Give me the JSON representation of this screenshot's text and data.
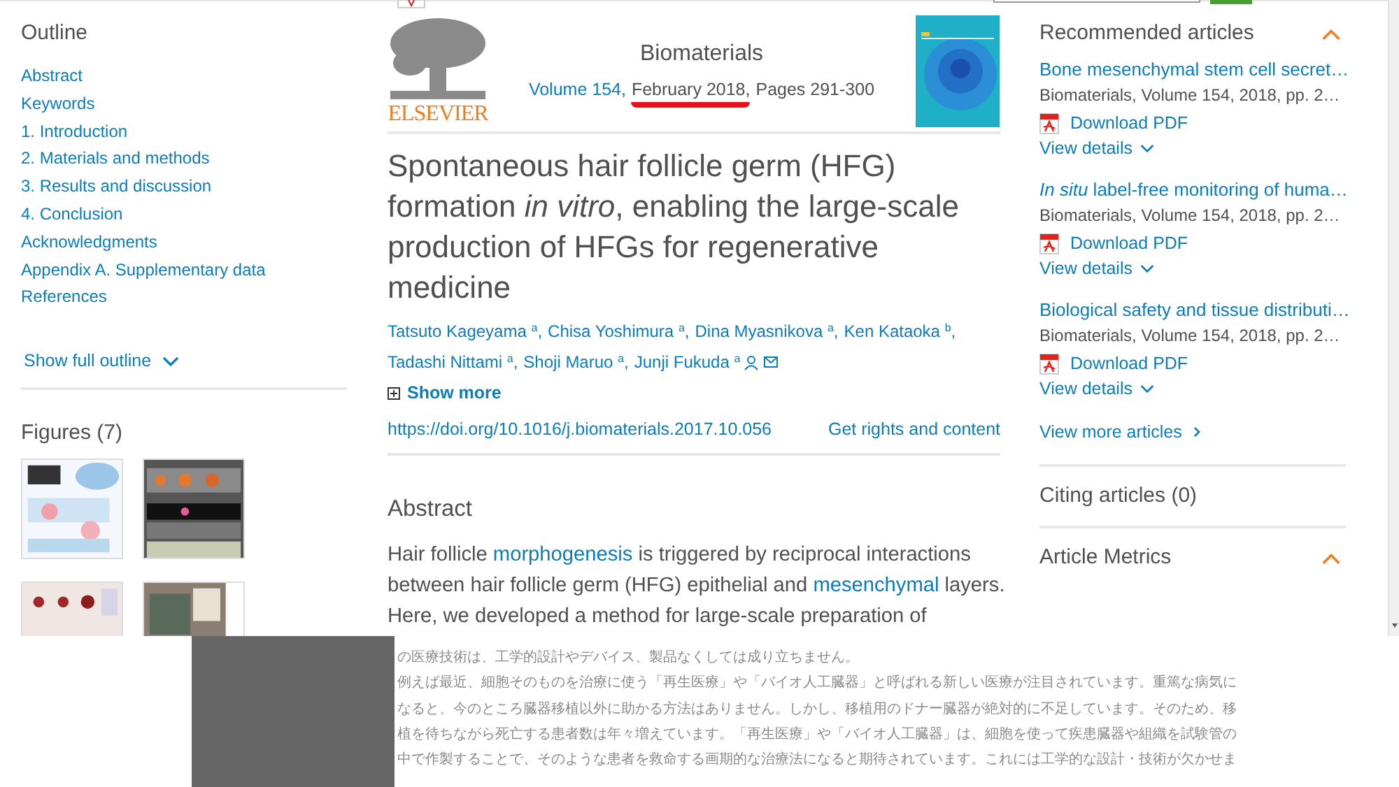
{
  "outline": {
    "title": "Outline",
    "items": [
      "Abstract",
      "Keywords",
      "1. Introduction",
      "2. Materials and methods",
      "3. Results and discussion",
      "4. Conclusion",
      "Acknowledgments",
      "Appendix A. Supplementary data",
      "References"
    ],
    "show_full": "Show full outline"
  },
  "figures": {
    "title": "Figures (7)"
  },
  "journal": {
    "publisher": "ELSEVIER",
    "name": "Biomaterials",
    "volume": "Volume 154,",
    "date": "February 2018,",
    "date_highlighted": true,
    "pages": "Pages 291-300"
  },
  "article": {
    "title": "Spontaneous hair follicle germ (HFG) formation *in vitro*, enabling the large-scale production of HFGs for regenerative medicine",
    "authors": [
      {
        "name": "Tatsuto Kageyama",
        "affiliation": "a",
        "separator": ",",
        "corresponding": false
      },
      {
        "name": "Chisa Yoshimura",
        "affiliation": "a",
        "separator": ",",
        "corresponding": false
      },
      {
        "name": "Dina Myasnikova",
        "affiliation": "a",
        "separator": ",",
        "corresponding": false
      },
      {
        "name": "Ken Kataoka",
        "affiliation": "b",
        "separator": ",",
        "corresponding": false
      },
      {
        "name": "Tadashi Nittami",
        "affiliation": "a",
        "separator": ",",
        "corresponding": false
      },
      {
        "name": "Shoji Maruo",
        "affiliation": "a",
        "separator": ",",
        "corresponding": false
      },
      {
        "name": "Junji Fukuda",
        "affiliation": "a",
        "corresponding": true
      }
    ],
    "show_more": "Show more",
    "doi": "https://doi.org/10.1016/j.biomaterials.2017.10.056",
    "rights": "Get rights and content"
  },
  "abstract": {
    "heading": "Abstract",
    "segments": [
      {
        "text": "Hair follicle ",
        "link": false
      },
      {
        "text": "morphogenesis",
        "link": true
      },
      {
        "text": " is triggered by reciprocal interactions between hair follicle germ (HFG) epithelial and ",
        "link": false
      },
      {
        "text": "mesenchymal",
        "link": true
      },
      {
        "text": " layers. Here, we developed a method for large-scale preparation of",
        "link": false
      }
    ]
  },
  "recommended": {
    "title": "Recommended articles",
    "expanded": true,
    "articles": [
      {
        "title": "Bone mesenchymal stem cell secret…",
        "source": "Biomaterials, Volume 154, 2018, pp. 2…",
        "download": "Download PDF",
        "details": "View details"
      },
      {
        "title": "*In situ* label-free monitoring of huma…",
        "source": "Biomaterials, Volume 154, 2018, pp. 2…",
        "download": "Download PDF",
        "details": "View details"
      },
      {
        "title": "Biological safety and tissue distributi…",
        "source": "Biomaterials, Volume 154, 2018, pp. 2…",
        "download": "Download PDF",
        "details": "View details"
      }
    ],
    "more": "View more articles"
  },
  "citing": {
    "title": "Citing articles (0)"
  },
  "metrics": {
    "title": "Article Metrics",
    "expanded": true
  },
  "overlay_text": {
    "lines": [
      "の医療技術は、工学的設計やデバイス、製品なくしては成り立ちません。",
      "例えば最近、細胞そのものを治療に使う「再生医療」や「バイオ人工臓器」と呼ばれる新しい医療が注目されています。重篤な病気に",
      "なると、今のところ臓器移植以外に助かる方法はありません。しかし、移植用のドナー臓器が絶対的に不足しています。そのため、移",
      "植を待ちながら死亡する患者数は年々増えています。「再生医療」や「バイオ人工臓器」は、細胞を使って疾患臓器や組織を試験管の",
      "中で作製することで、そのような患者を救命する画期的な治療法になると期待されています。これには工学的な設計・技術が欠かせま"
    ]
  }
}
